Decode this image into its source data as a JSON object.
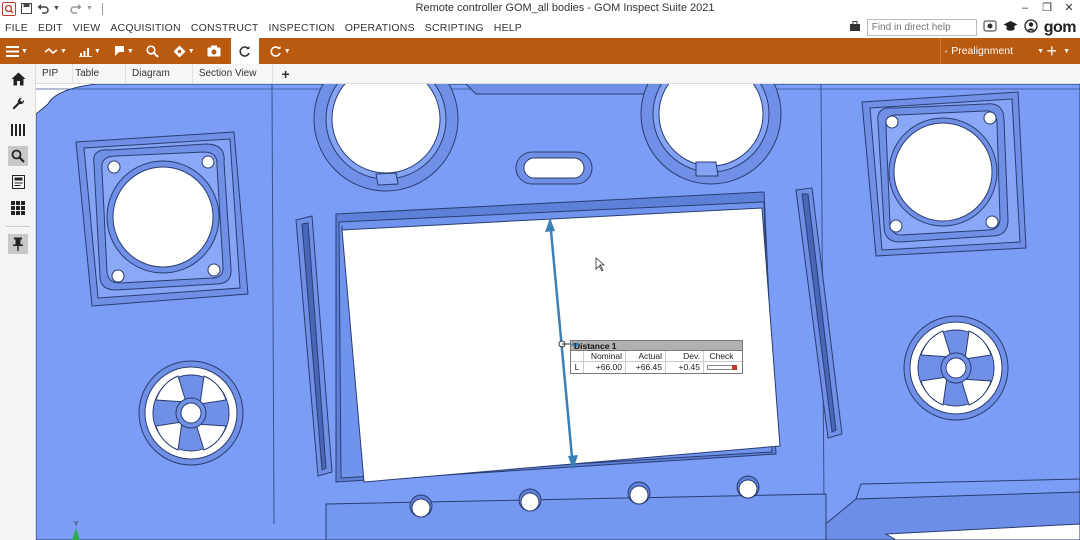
{
  "window": {
    "title": "Remote controller GOM_all bodies - GOM Inspect Suite 2021",
    "controls": [
      "–",
      "❐",
      "✕"
    ]
  },
  "menu": {
    "items": [
      "FILE",
      "EDIT",
      "VIEW",
      "ACQUISITION",
      "CONSTRUCT",
      "INSPECTION",
      "OPERATIONS",
      "SCRIPTING",
      "HELP"
    ],
    "search_placeholder": "Find in direct help",
    "logo": "gom"
  },
  "toolbar": {
    "alignment_label": "Prealignment"
  },
  "tabs": [
    "PIP",
    "Table",
    "Diagram",
    "Section View"
  ],
  "tab_add": "+",
  "measurement_label": {
    "title": "Distance 1",
    "headers": [
      "Nominal",
      "Actual",
      "Dev.",
      "Check"
    ],
    "row_prefix": "L",
    "nominal": "+66.00",
    "actual": "+66.45",
    "deviation": "+0.45"
  },
  "colors": {
    "toolbar": "#b85a10",
    "part_blue": "#7a9cf5",
    "part_edge": "#2a3d70",
    "measure_line": "#3a80b8",
    "check_fail": "#c0392b"
  }
}
